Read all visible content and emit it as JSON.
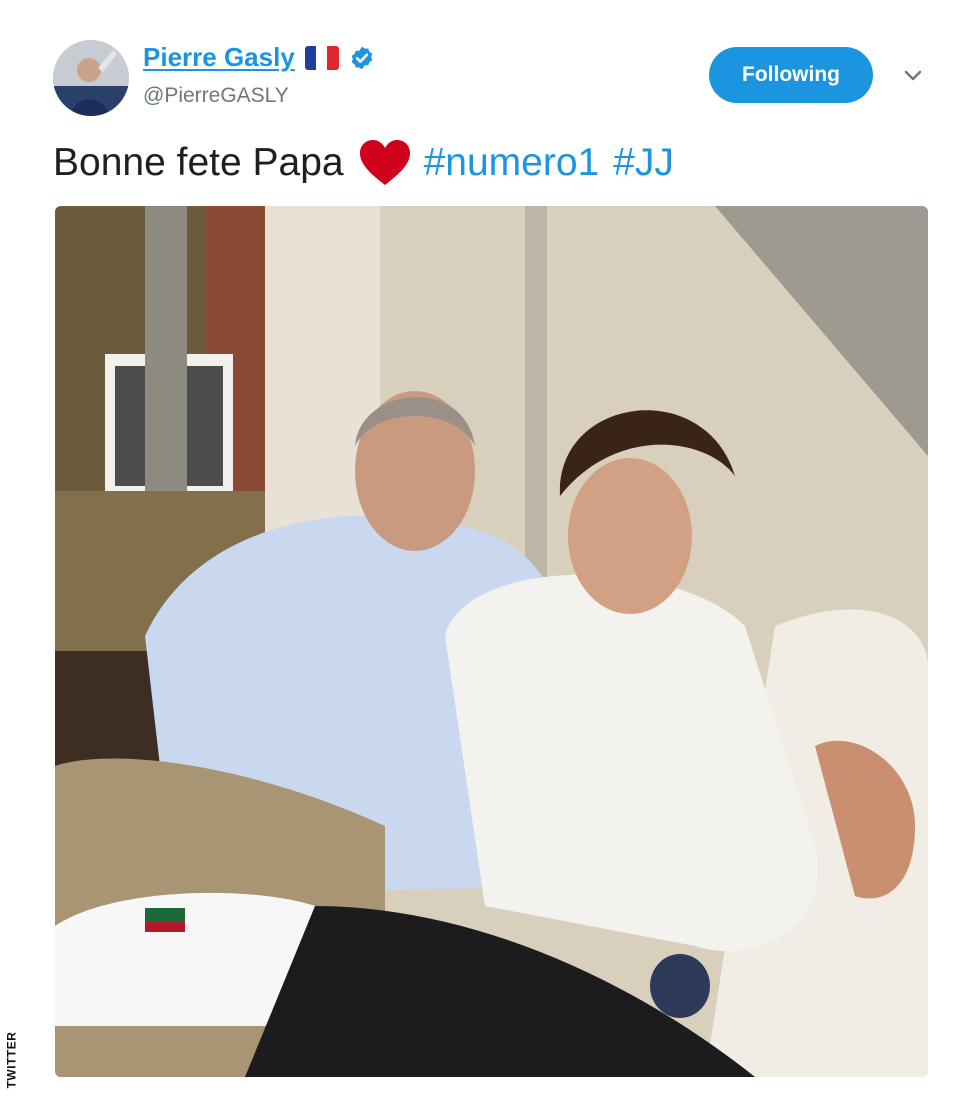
{
  "tweet": {
    "author": {
      "display_name": "Pierre Gasly",
      "handle": "@PierreGASLY",
      "flag": "french-flag",
      "verified_icon": "verified-badge-icon"
    },
    "follow_button_label": "Following",
    "menu_icon": "chevron-down-icon",
    "text_before": "Bonne fete Papa",
    "emoji": "red-heart-emoji",
    "hashtags": [
      "#numero1",
      "#JJ"
    ]
  },
  "watermark": "TWITTER",
  "colors": {
    "accent": "#1b95e0",
    "text": "#1c2022",
    "muted": "#697882",
    "heart": "#d0021b"
  }
}
